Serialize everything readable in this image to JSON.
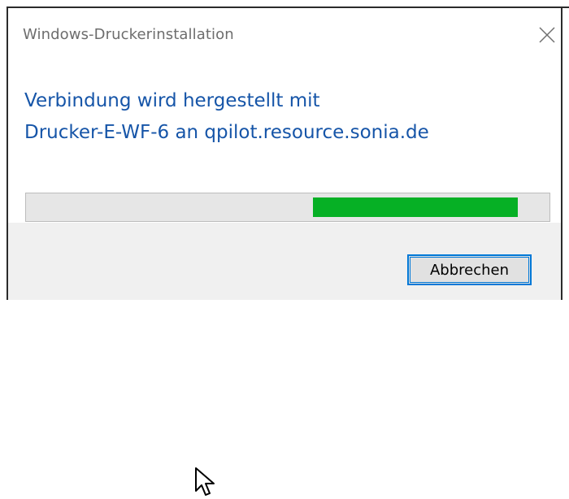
{
  "window": {
    "title": "Windows-Druckerinstallation"
  },
  "message": {
    "line1": "Verbindung wird hergestellt mit",
    "line2": "Drucker-E-WF-6 an qpilot.resource.sonia.de"
  },
  "progress": {
    "type": "marquee",
    "segment_start_fraction": 0.548,
    "segment_end_fraction": 0.94,
    "color": "#06b025"
  },
  "buttons": {
    "cancel_label": "Abbrechen"
  },
  "icons": {
    "close": "close-icon",
    "cursor": "mouse-pointer-icon"
  },
  "colors": {
    "message_text": "#1655a8",
    "accent_border": "#0078d7",
    "footer_bg": "#f0f0f0"
  }
}
